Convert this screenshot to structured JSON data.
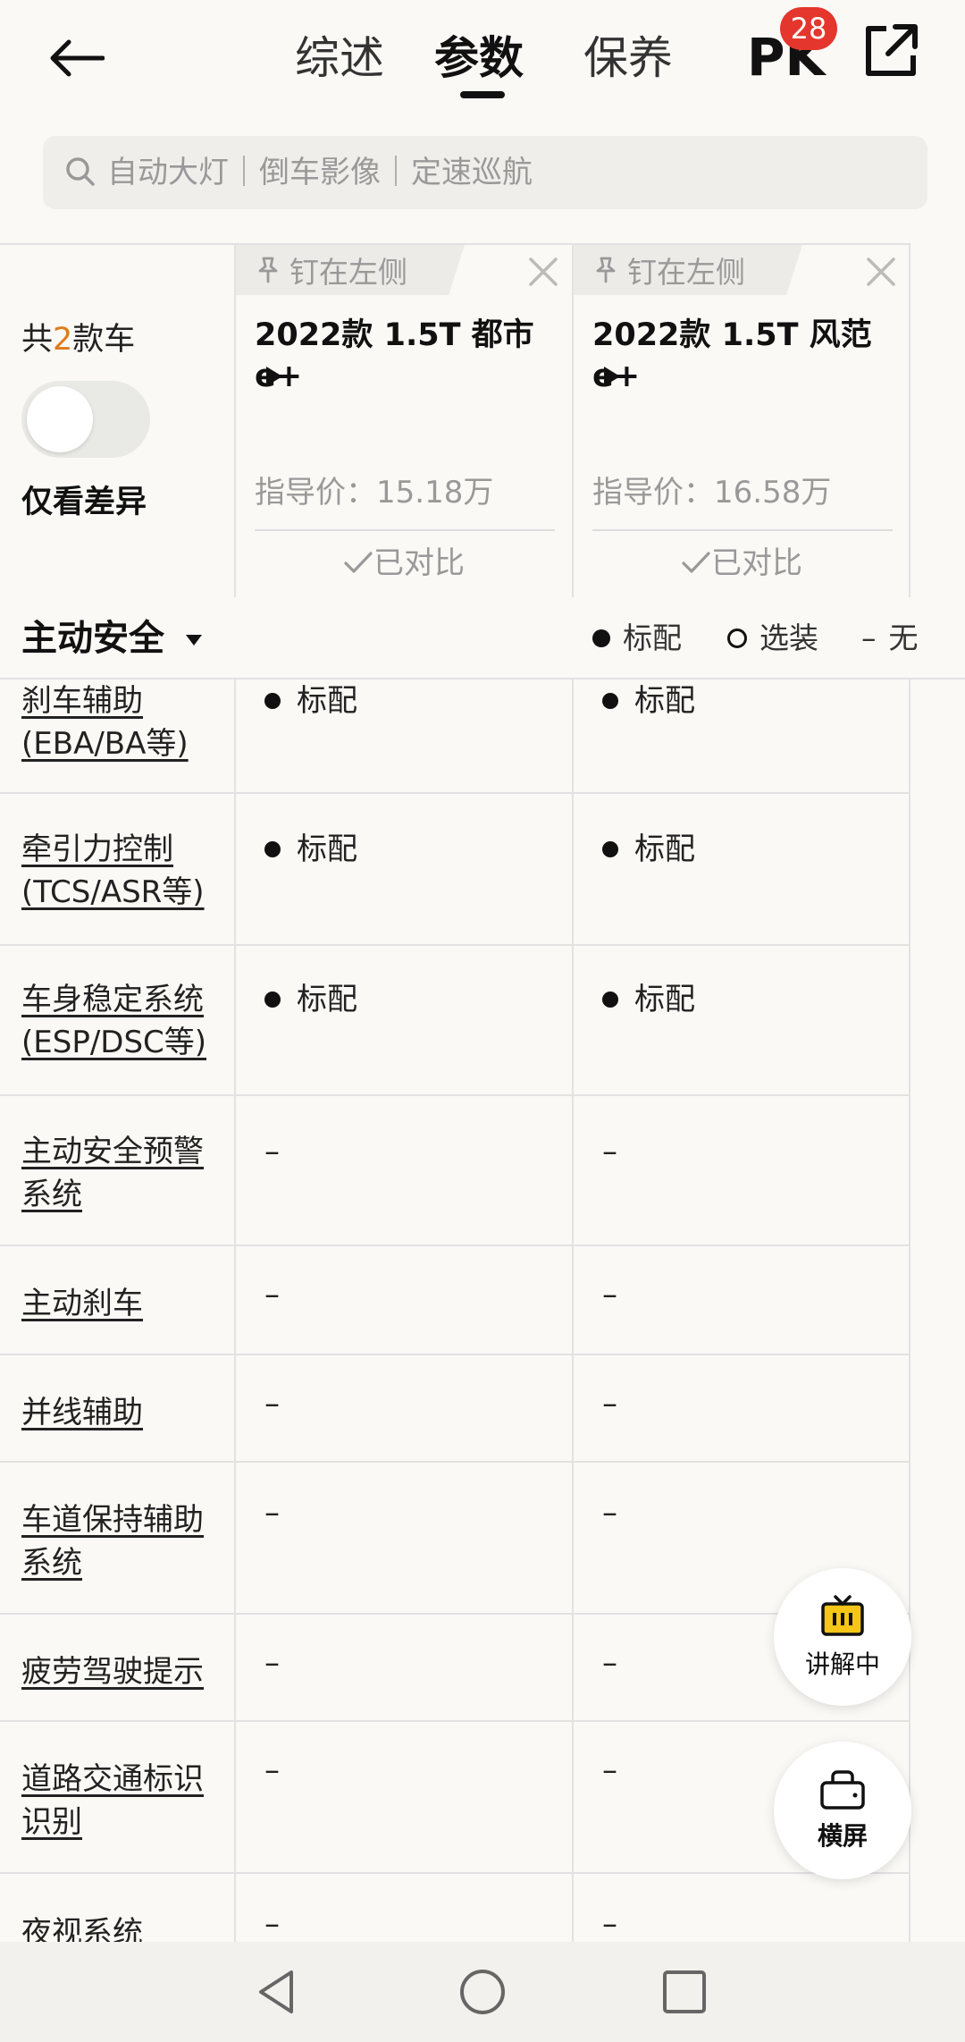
{
  "header": {
    "tabs": [
      {
        "label": "综述",
        "active": false
      },
      {
        "label": "参数",
        "active": true
      },
      {
        "label": "保养",
        "active": false
      }
    ],
    "pk_label": "PK",
    "pk_badge": "28"
  },
  "search": {
    "placeholder": "自动大灯｜倒车影像｜定速巡航"
  },
  "compare": {
    "count_prefix": "共",
    "count_num": "2",
    "count_suffix": "款车",
    "diff_label": "仅看差异",
    "diff_toggle_on": false,
    "cars": [
      {
        "pin_label": "钉在左侧",
        "name": "2022款 1.5T 都市e+",
        "price": "指导价：15.18万",
        "compared_label": "已对比"
      },
      {
        "pin_label": "钉在左侧",
        "name": "2022款 1.5T 风范e+",
        "price": "指导价：16.58万",
        "compared_label": "已对比"
      }
    ]
  },
  "section": {
    "title": "主动安全",
    "legend": {
      "standard": "标配",
      "optional": "选装",
      "none_symbol": "–",
      "none": "无"
    }
  },
  "rows": [
    {
      "label": "刹车辅助(EBA/BA等)",
      "values": [
        "标配",
        "标配"
      ],
      "standard": [
        true,
        true
      ]
    },
    {
      "label": "牵引力控制(TCS/ASR等)",
      "values": [
        "标配",
        "标配"
      ],
      "standard": [
        true,
        true
      ]
    },
    {
      "label": "车身稳定系统(ESP/DSC等)",
      "values": [
        "标配",
        "标配"
      ],
      "standard": [
        true,
        true
      ]
    },
    {
      "label": "主动安全预警系统",
      "values": [
        "–",
        "–"
      ],
      "standard": [
        false,
        false
      ]
    },
    {
      "label": "主动刹车",
      "values": [
        "–",
        "–"
      ],
      "standard": [
        false,
        false
      ]
    },
    {
      "label": "并线辅助",
      "values": [
        "–",
        "–"
      ],
      "standard": [
        false,
        false
      ]
    },
    {
      "label": "车道保持辅助系统",
      "values": [
        "–",
        "–"
      ],
      "standard": [
        false,
        false
      ]
    },
    {
      "label": "疲劳驾驶提示",
      "values": [
        "–",
        "–"
      ],
      "standard": [
        false,
        false
      ]
    },
    {
      "label": "道路交通标识识别",
      "values": [
        "–",
        "–"
      ],
      "standard": [
        false,
        false
      ]
    },
    {
      "label": "夜视系统",
      "values": [
        "–",
        "–"
      ],
      "standard": [
        false,
        false
      ]
    }
  ],
  "floating": {
    "explain_label": "讲解中",
    "landscape_label": "横屏"
  },
  "colors": {
    "accent_orange": "#e07a1c",
    "badge_red": "#e4362c",
    "background": "#faf9f6"
  }
}
